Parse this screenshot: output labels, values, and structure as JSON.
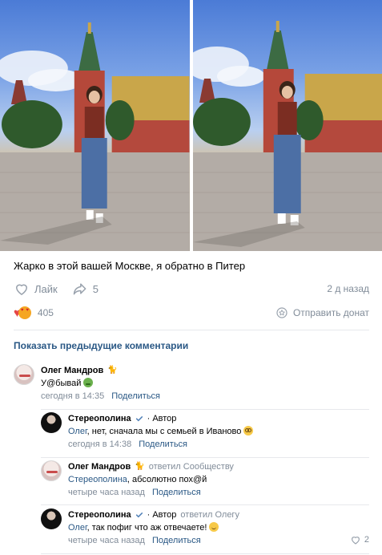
{
  "post": {
    "caption": "Жарко в этой вашей Москве, я обратно в Питер",
    "like_label": "Лайк",
    "share_count": "5",
    "date": "2 д назад",
    "reactions_count": "405",
    "donate_label": "Отправить донат"
  },
  "comments_section": {
    "show_previous_label": "Показать предыдущие комментарии"
  },
  "comments": [
    {
      "author": "Олег Мандров",
      "badge": "🐈",
      "text": "У@бывай",
      "time": "сегодня в 14:35",
      "share_label": "Поделиться"
    },
    {
      "author": "Стереополина",
      "author_tag": "· Автор",
      "reply_to": "Олег",
      "text": ", нет, сначала мы с семьей в Иваново",
      "time": "сегодня в 14:38",
      "share_label": "Поделиться"
    },
    {
      "author": "Олег Мандров",
      "badge": "🐈",
      "replied_note": "ответил Сообществу",
      "reply_to": "Стереополина",
      "text": ", абсолютно пох@й",
      "time": "четыре часа назад",
      "share_label": "Поделиться"
    },
    {
      "author": "Стереополина",
      "author_tag": "· Автор",
      "replied_note": "ответил Олегу",
      "reply_to": "Олег",
      "text": ", так пофиг что аж отвечаете!",
      "time": "четыре часа назад",
      "share_label": "Поделиться",
      "likes": "2"
    }
  ],
  "colors": {
    "link": "#2a5885",
    "muted": "#818c99",
    "verified": "#5181b8",
    "heart": "#e64646"
  }
}
